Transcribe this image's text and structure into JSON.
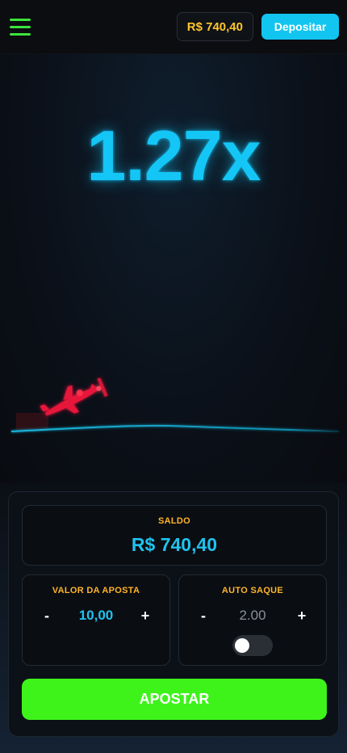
{
  "header": {
    "menu_icon": "hamburger-menu-icon",
    "balance": "R$ 740,40",
    "deposit_label": "Depositar"
  },
  "game": {
    "multiplier": "1.27x",
    "plane_icon": "airplane-icon",
    "colors": {
      "multiplier": "#14c6f6",
      "plane": "#e8143a",
      "trail": "#17c1ea"
    }
  },
  "panel": {
    "saldo_label": "SALDO",
    "saldo_value": "R$ 740,40",
    "bet": {
      "label": "VALOR DA APOSTA",
      "minus": "-",
      "value": "10,00",
      "plus": "+"
    },
    "auto": {
      "label": "AUTO SAQUE",
      "minus": "-",
      "value": "2.00",
      "plus": "+",
      "toggle_on": false
    },
    "apostar_label": "APOSTAR"
  },
  "colors": {
    "accent_blue": "#12c5f0",
    "accent_green": "#3ef31a",
    "accent_gold": "#ffc629",
    "menu_green": "#39e53a"
  }
}
